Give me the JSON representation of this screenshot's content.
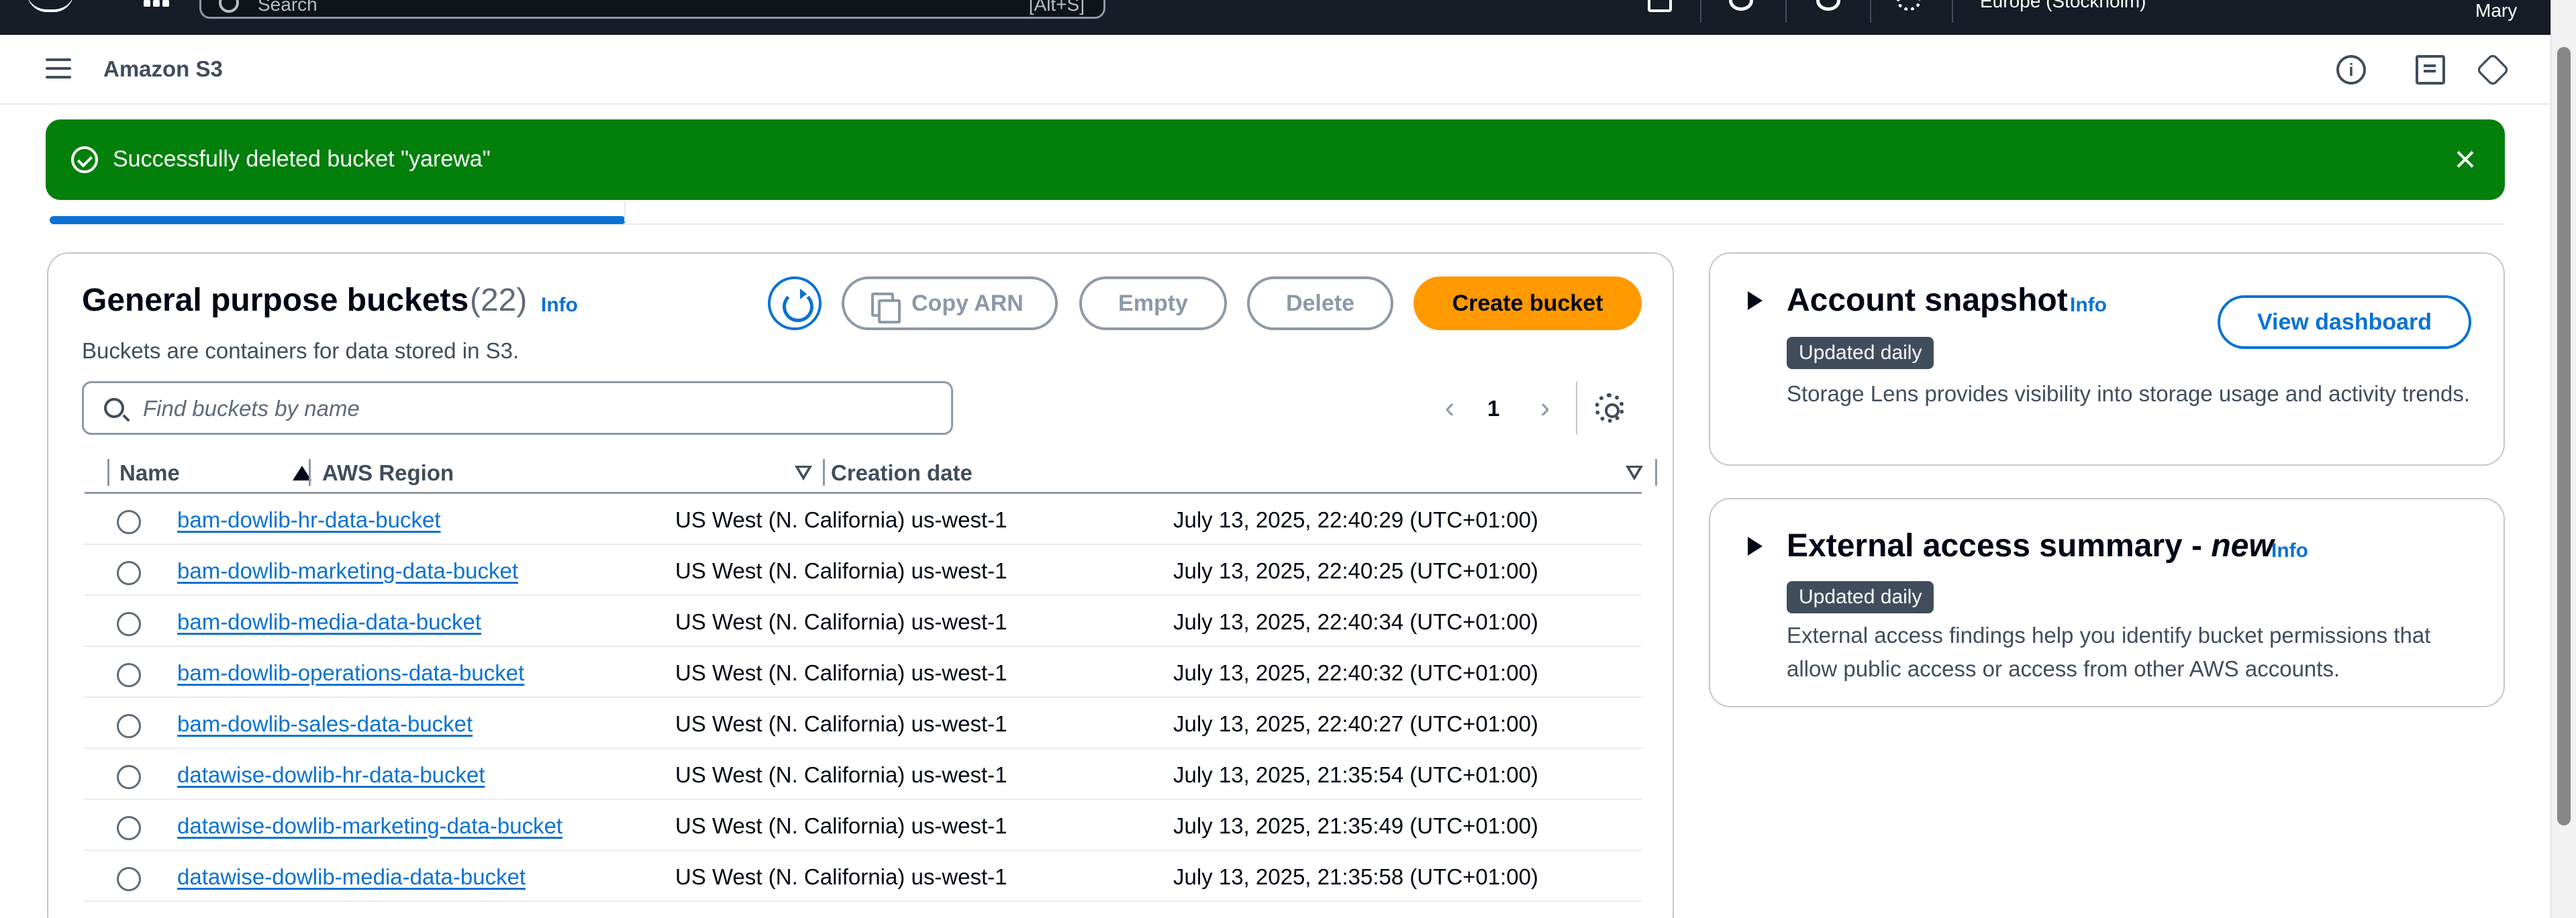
{
  "topnav": {
    "search_placeholder": "Search",
    "search_shortcut": "[Alt+S]",
    "region": "Europe (Stockholm)",
    "user": "Mary"
  },
  "header": {
    "service_title": "Amazon S3"
  },
  "flash": {
    "message": "Successfully deleted bucket \"yarewa\""
  },
  "buckets": {
    "title": "General purpose buckets",
    "count": "(22)",
    "info": "Info",
    "description": "Buckets are containers for data stored in S3.",
    "copy_arn_label": "Copy ARN",
    "empty_label": "Empty",
    "delete_label": "Delete",
    "create_label": "Create bucket",
    "search_placeholder": "Find buckets by name",
    "page": "1",
    "columns": {
      "name": "Name",
      "region": "AWS Region",
      "created": "Creation date"
    },
    "rows": [
      {
        "name": "bam-dowlib-hr-data-bucket",
        "region": "US West (N. California) us-west-1",
        "created": "July 13, 2025, 22:40:29 (UTC+01:00)"
      },
      {
        "name": "bam-dowlib-marketing-data-bucket",
        "region": "US West (N. California) us-west-1",
        "created": "July 13, 2025, 22:40:25 (UTC+01:00)"
      },
      {
        "name": "bam-dowlib-media-data-bucket",
        "region": "US West (N. California) us-west-1",
        "created": "July 13, 2025, 22:40:34 (UTC+01:00)"
      },
      {
        "name": "bam-dowlib-operations-data-bucket",
        "region": "US West (N. California) us-west-1",
        "created": "July 13, 2025, 22:40:32 (UTC+01:00)"
      },
      {
        "name": "bam-dowlib-sales-data-bucket",
        "region": "US West (N. California) us-west-1",
        "created": "July 13, 2025, 22:40:27 (UTC+01:00)"
      },
      {
        "name": "datawise-dowlib-hr-data-bucket",
        "region": "US West (N. California) us-west-1",
        "created": "July 13, 2025, 21:35:54 (UTC+01:00)"
      },
      {
        "name": "datawise-dowlib-marketing-data-bucket",
        "region": "US West (N. California) us-west-1",
        "created": "July 13, 2025, 21:35:49 (UTC+01:00)"
      },
      {
        "name": "datawise-dowlib-media-data-bucket",
        "region": "US West (N. California) us-west-1",
        "created": "July 13, 2025, 21:35:58 (UTC+01:00)"
      }
    ]
  },
  "account_snapshot": {
    "title": "Account snapshot",
    "info": "Info",
    "badge": "Updated daily",
    "description": "Storage Lens provides visibility into storage usage and activity trends.",
    "view_dashboard_label": "View dashboard"
  },
  "external_access": {
    "title": "External access summary - ",
    "title_new": "new",
    "info": "Info",
    "badge": "Updated daily",
    "description": "External access findings help you identify bucket permissions that allow public access or access from other AWS accounts."
  },
  "colors": {
    "success_green": "#037f0c",
    "link_blue": "#0972d3",
    "primary_orange": "#ff9900",
    "nav_dark": "#161d26"
  }
}
